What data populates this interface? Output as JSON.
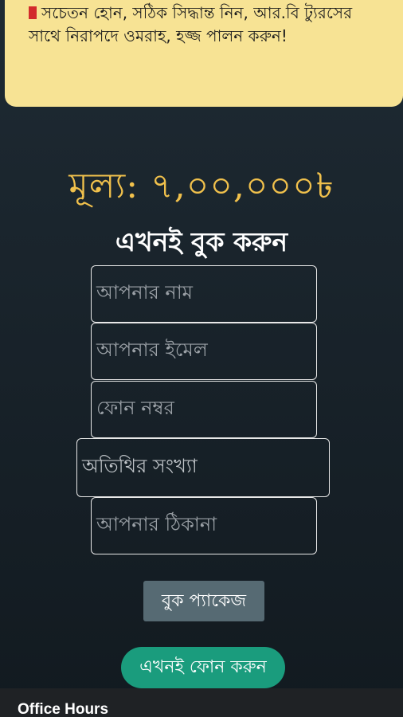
{
  "notice": {
    "text": "সচেতন হোন, সঠিক সিদ্ধান্ত নিন, আর.বি ট্যুরসের সাথে নিরাপদে ওমরাহ, হজ্জ পালন করুন!"
  },
  "price": {
    "text": "মূল্য: ৭,০০,০০০৳"
  },
  "booking": {
    "title": "এখনই বুক করুন",
    "name_placeholder": "আপনার নাম",
    "email_placeholder": "আপনার ইমেল",
    "phone_placeholder": "ফোন নম্বর",
    "guests_placeholder": "অতিথির সংখ্যা",
    "address_placeholder": "আপনার ঠিকানা",
    "submit_label": "বুক প্যাকেজ"
  },
  "call_label": "এখনই ফোন করুন",
  "footer": {
    "office_hours": "Office Hours"
  },
  "colors": {
    "notice_bg": "#f7e394",
    "price": "#f1c14c",
    "call_button": "#1a9c7d",
    "book_button": "#566a73"
  }
}
